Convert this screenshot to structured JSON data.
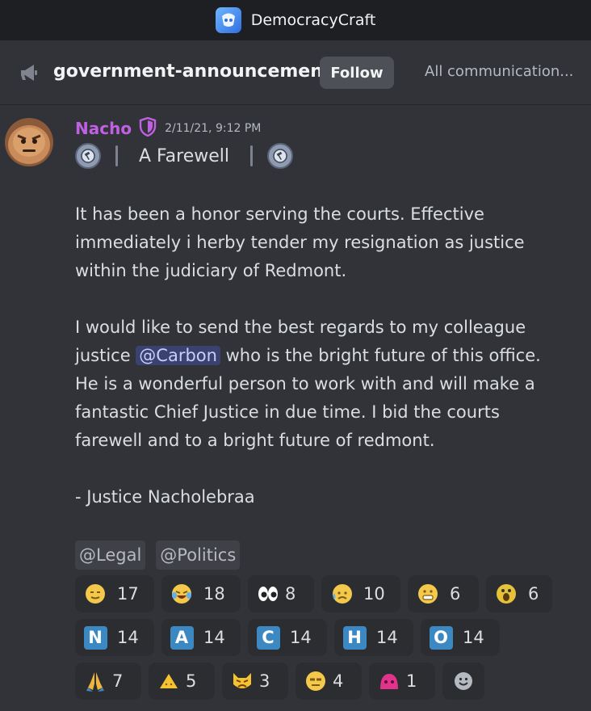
{
  "window": {
    "title": "DemocracyCraft"
  },
  "channel": {
    "name": "government-announcements",
    "follow_label": "Follow",
    "topic": "All communication..."
  },
  "message": {
    "author": "Nacho",
    "author_color": "#c061e4",
    "timestamp": "2/11/21, 9:12 PM",
    "title": "A Farewell",
    "paragraph1": "It has been a honor serving the courts. Effective immediately i herby tender my resignation as justice within the judiciary of Redmont.",
    "paragraph2_before": "I would like to send the best regards to my colleague justice ",
    "mention": "@Carbon",
    "paragraph2_after": "  who is the bright future of this office. He is a wonderful person to work with and will make a fantastic Chief Justice in due time. I bid the courts farewell and to a bright future of redmont.",
    "signature": "- Justice Nacholebraa",
    "role_mentions": [
      "@Legal",
      "@Politics"
    ]
  },
  "reactions": [
    [
      {
        "emoji": "yellow-face-icon",
        "count": "17"
      },
      {
        "emoji": "crying-laughing-face-icon",
        "count": "18"
      },
      {
        "emoji": "eyes-icon",
        "count": "8"
      },
      {
        "emoji": "sad-tear-face-icon",
        "count": "10"
      },
      {
        "emoji": "grimacing-face-icon",
        "count": "6"
      },
      {
        "emoji": "surprised-face-icon",
        "count": "6"
      }
    ],
    [
      {
        "emoji": "regional-n-icon",
        "letter": "N",
        "count": "14"
      },
      {
        "emoji": "regional-a-icon",
        "letter": "A",
        "count": "14"
      },
      {
        "emoji": "regional-c-icon",
        "letter": "C",
        "count": "14"
      },
      {
        "emoji": "regional-h-icon",
        "letter": "H",
        "count": "14"
      },
      {
        "emoji": "regional-o-icon",
        "letter": "O",
        "count": "14"
      }
    ],
    [
      {
        "emoji": "folded-hands-icon",
        "count": "7"
      },
      {
        "emoji": "warning-triangle-face-icon",
        "count": "5"
      },
      {
        "emoji": "angry-cat-icon",
        "count": "3"
      },
      {
        "emoji": "unamused-face-icon",
        "count": "4"
      },
      {
        "emoji": "pink-blob-icon",
        "count": "1"
      }
    ]
  ],
  "add_reaction": {
    "icon": "add-reaction-icon"
  }
}
